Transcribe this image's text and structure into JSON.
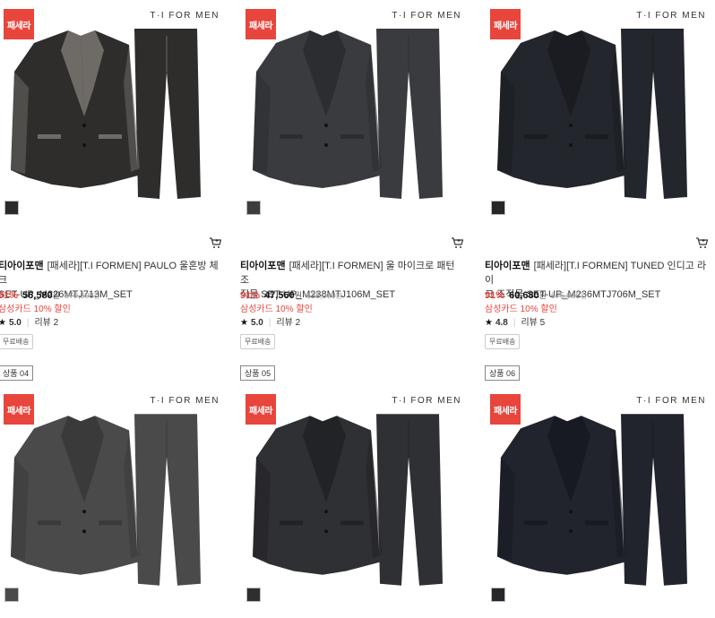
{
  "products": [
    {
      "badge": "패세라",
      "brandmark": "T·I FOR MEN",
      "brand": "티아이포맨",
      "name_line1": "[패세라][T.I FORMEN] PAULO 울혼방 체크",
      "name_line2": "SET-UP_M226MTJ713M_SET",
      "discount": "91%",
      "price": "56,580",
      "currency": "원",
      "original_price": "670,000",
      "original_currency": "원",
      "card_promo": "삼성카드 10% 할인",
      "star": "★",
      "score": "5.0",
      "reviews": "리뷰 2",
      "shipping": "무료배송",
      "rank": "",
      "suit_color": "#2e2d2b",
      "lapel_color": "#6e6a66",
      "swatch_color": "#2b2a28"
    },
    {
      "badge": "패세라",
      "brandmark": "T·I FOR MEN",
      "brand": "티아이포맨",
      "name_line1": "[패세라][T.I FORMEN] 울 마이크로 패턴 조",
      "name_line2": "직물 SET-UP_M238MTJ106M_SET",
      "discount": "91%",
      "price": "47,560",
      "currency": "원",
      "original_price": "538,000",
      "original_currency": "원",
      "card_promo": "삼성카드 10% 할인",
      "star": "★",
      "score": "5.0",
      "reviews": "리뷰 2",
      "shipping": "무료배송",
      "rank": "",
      "suit_color": "#3a3b3e",
      "lapel_color": "#2c2d30",
      "swatch_color": "#3c3d40"
    },
    {
      "badge": "패세라",
      "brandmark": "T·I FOR MEN",
      "brand": "티아이포맨",
      "name_line1": "[패세라][T.I FORMEN] TUNED 인디고 라이",
      "name_line2": "크 조직물 SET-UP_M236MTJ706M_SET",
      "discount": "91%",
      "price": "60,680",
      "currency": "원",
      "original_price": "675,000",
      "original_currency": "원",
      "card_promo": "삼성카드 10% 할인",
      "star": "★",
      "score": "4.8",
      "reviews": "리뷰 5",
      "shipping": "무료배송",
      "rank": "",
      "suit_color": "#23262c",
      "lapel_color": "#1a1c21",
      "swatch_color": "#25272b"
    },
    {
      "badge": "패세라",
      "brandmark": "T·I FOR MEN",
      "brand": "",
      "name_line1": "",
      "name_line2": "",
      "discount": "",
      "price": "",
      "currency": "",
      "original_price": "",
      "original_currency": "",
      "card_promo": "",
      "star": "",
      "score": "",
      "reviews": "",
      "shipping": "",
      "rank": "상품 04",
      "suit_color": "#4a4a4a",
      "lapel_color": "#3a3a3a",
      "swatch_color": "#4a4a4a"
    },
    {
      "badge": "패세라",
      "brandmark": "T·I FOR MEN",
      "brand": "",
      "name_line1": "",
      "name_line2": "",
      "discount": "",
      "price": "",
      "currency": "",
      "original_price": "",
      "original_currency": "",
      "card_promo": "",
      "star": "",
      "score": "",
      "reviews": "",
      "shipping": "",
      "rank": "상품 05",
      "suit_color": "#2f3033",
      "lapel_color": "#222326",
      "swatch_color": "#2e2f31"
    },
    {
      "badge": "패세라",
      "brandmark": "T·I FOR MEN",
      "brand": "",
      "name_line1": "",
      "name_line2": "",
      "discount": "",
      "price": "",
      "currency": "",
      "original_price": "",
      "original_currency": "",
      "card_promo": "",
      "star": "",
      "score": "",
      "reviews": "",
      "shipping": "",
      "rank": "상품 06",
      "suit_color": "#22242d",
      "lapel_color": "#181a22",
      "swatch_color": "#26272b"
    }
  ],
  "colors": {
    "accent": "#e8453c"
  }
}
